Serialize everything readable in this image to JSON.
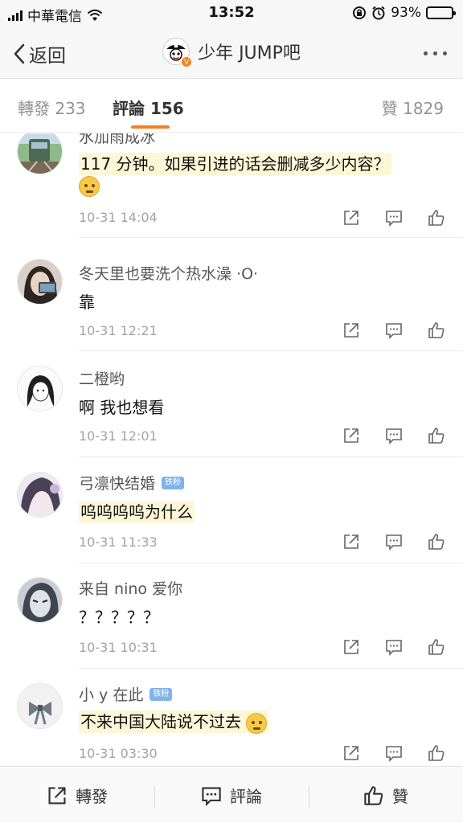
{
  "status_bar": {
    "carrier": "中華電信",
    "time": "13:52",
    "battery": "93%",
    "battery_level": 0.93
  },
  "nav": {
    "back_label": "返回",
    "title": "少年 JUMP吧"
  },
  "tabs": {
    "repost": "轉發 233",
    "comment": "評論 156",
    "like": "贊 1829"
  },
  "comments": [
    {
      "name": "水加雨成冰",
      "text": "117 分钟。如果引进的话会删减多少内容？",
      "emoji": "thinking-emoji",
      "time": "10-31 14:04",
      "highlight": true,
      "badge": ""
    },
    {
      "name": "冬天里也要洗个热水澡 ·O·",
      "text": "靠",
      "emoji": "",
      "time": "10-31 12:21",
      "highlight": false,
      "badge": ""
    },
    {
      "name": "二橙哟",
      "text": "啊 我也想看",
      "emoji": "",
      "time": "10-31 12:01",
      "highlight": false,
      "badge": ""
    },
    {
      "name": "弓凛快结婚",
      "text": "呜呜呜呜为什么",
      "emoji": "",
      "time": "10-31 11:33",
      "highlight": true,
      "badge": "铁粉"
    },
    {
      "name": "来自 nino 爱你",
      "text": "？？？？？",
      "emoji": "",
      "time": "10-31 10:31",
      "highlight": false,
      "badge": ""
    },
    {
      "name": "小 y 在此",
      "text": "不来中国大陆说不过去",
      "emoji": "eye-roll-emoji",
      "time": "10-31 03:30",
      "highlight": true,
      "badge": "铁粉"
    }
  ],
  "toolbar": {
    "repost": "轉發",
    "comment": "評論",
    "like": "贊"
  },
  "colors": {
    "accent": "#f58220",
    "highlight": "#fdf7d8",
    "badge": "#7fb4ea"
  }
}
